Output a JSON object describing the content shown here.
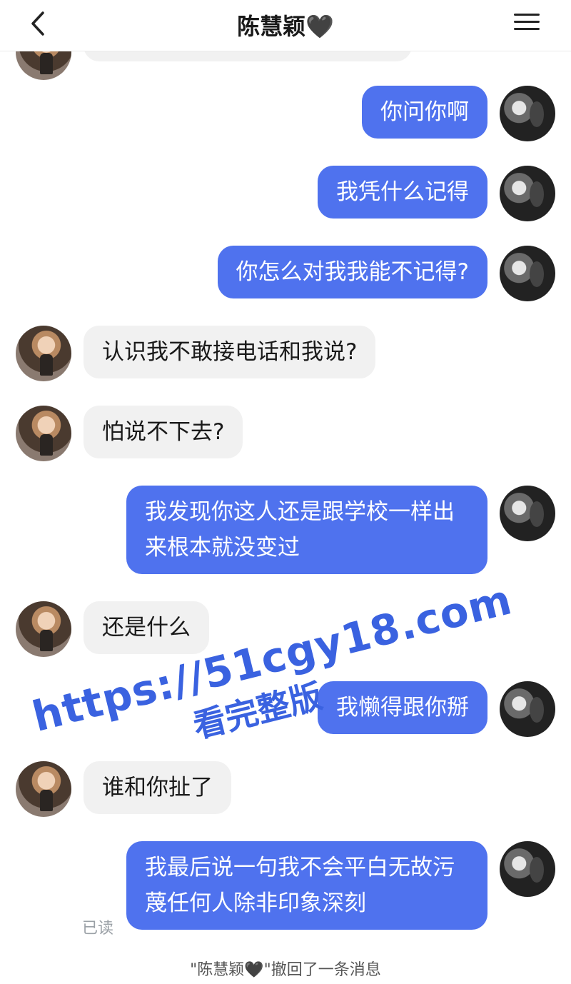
{
  "header": {
    "title": "陈慧颖🖤",
    "back_icon": "chevron-left-icon",
    "menu_icon": "hamburger-menu-icon"
  },
  "messages": [
    {
      "side": "me",
      "text": "你问你啊"
    },
    {
      "side": "me",
      "text": "我凭什么记得"
    },
    {
      "side": "me",
      "text": "你怎么对我我能不记得?"
    },
    {
      "side": "other",
      "text": "认识我不敢接电话和我说?"
    },
    {
      "side": "other",
      "text": "怕说不下去?"
    },
    {
      "side": "me",
      "text": "我发现你这人还是跟学校一样出来根本就没变过"
    },
    {
      "side": "other",
      "text": "还是什么"
    },
    {
      "side": "me",
      "text": "我懒得跟你掰"
    },
    {
      "side": "other",
      "text": "谁和你扯了"
    },
    {
      "side": "me",
      "text": "我最后说一句我不会平白无故污蔑任何人除非印象深刻"
    }
  ],
  "read_status": "已读",
  "recall_notice": "\"陈慧颖🖤\"撤回了一条消息",
  "watermark": {
    "url": "https://51cgy18.com",
    "subtitle": "看完整版"
  },
  "colors": {
    "my_bubble": "#4f72ee",
    "other_bubble": "#f1f1f1",
    "watermark": "#3a62e0"
  }
}
